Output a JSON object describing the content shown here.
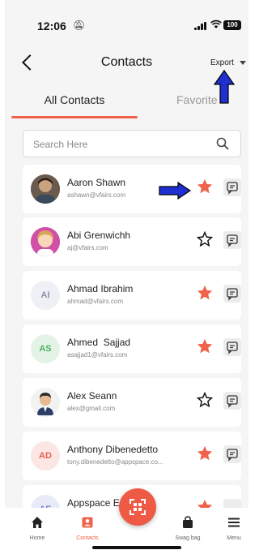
{
  "status_bar": {
    "time": "12:06",
    "battery": "100"
  },
  "header": {
    "title": "Contacts",
    "export_label": "Export"
  },
  "tabs": [
    {
      "label": "All Contacts",
      "active": true
    },
    {
      "label": "Favorite",
      "active": false
    }
  ],
  "search": {
    "placeholder": "Search Here"
  },
  "contacts": [
    {
      "name": "Aaron Shawn",
      "email": "ashawn@vfairs.com",
      "avatar": "photo",
      "favorite": true
    },
    {
      "name": "Abi Grenwichh",
      "email": "aj@vfairs.com",
      "avatar": "illustration",
      "favorite": false
    },
    {
      "name": "Ahmad Ibrahim",
      "email": "ahmad@vfairs.com",
      "initials": "AI",
      "favorite": true
    },
    {
      "name": "Ahmed  Sajjad",
      "email": "asajjad1@vfairs.com",
      "initials": "AS",
      "favorite": true
    },
    {
      "name": "Alex Seann",
      "email": "alex@gmail.com",
      "avatar": "illustration",
      "favorite": false
    },
    {
      "name": "Anthony Dibenedetto",
      "email": "tony.dibenedetto@appspace.co...",
      "initials": "AD",
      "favorite": true
    },
    {
      "name": "Appspace E...",
      "email": "",
      "initials": "AE",
      "favorite": true
    }
  ],
  "bottom_nav": [
    {
      "label": "Home",
      "icon": "home-icon"
    },
    {
      "label": "Contacts",
      "icon": "contacts-icon",
      "active": true
    },
    {
      "label": "Swag bag",
      "icon": "bag-icon"
    },
    {
      "label": "Menu",
      "icon": "menu-icon"
    }
  ],
  "colors": {
    "accent": "#f0624b",
    "annotation": "#1f2fd0"
  }
}
